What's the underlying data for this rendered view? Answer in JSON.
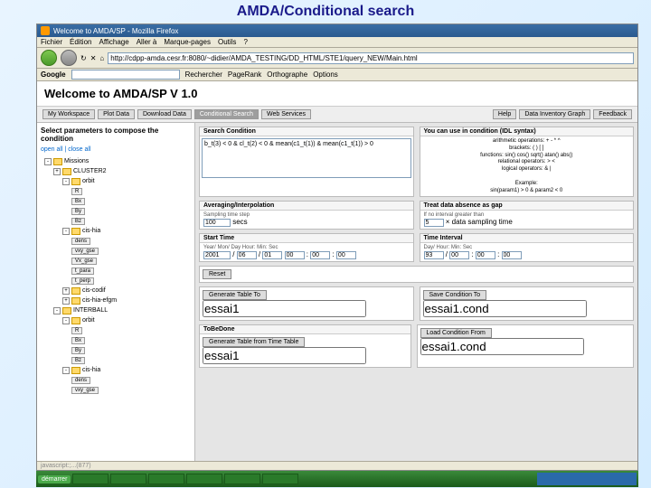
{
  "slide_title": "AMDA/Conditional search",
  "window_title": "Welcome to AMDA/SP - Mozilla Firefox",
  "menubar": [
    "Fichier",
    "Édition",
    "Affichage",
    "Aller à",
    "Marque-pages",
    "Outils",
    "?"
  ],
  "address_url": "http://cdpp-amda.cesr.fr:8080/~didier/AMDA_TESTING/DD_HTML/STE1/query_NEW/Main.html",
  "google_bar": {
    "logo": "Google",
    "items": [
      "Rechercher",
      "PageRank",
      "Orthographe",
      "Options"
    ]
  },
  "page_title": "Welcome to AMDA/SP V 1.0",
  "tabs_left": [
    "My Workspace",
    "Plot Data",
    "Download Data",
    "Conditional Search",
    "Web Services"
  ],
  "tabs_right": [
    "Help",
    "Data Inventory Graph",
    "Feedback"
  ],
  "active_tab": "Conditional Search",
  "sidebar": {
    "heading": "Select parameters to compose the condition",
    "expand_links": "open all | close all",
    "tree": [
      {
        "lvl": 0,
        "t": "toggle",
        "s": "-",
        "label": "Missions",
        "fold": true
      },
      {
        "lvl": 1,
        "t": "toggle",
        "s": "+",
        "label": "CLUSTER2",
        "fold": true
      },
      {
        "lvl": 2,
        "t": "toggle",
        "s": "-",
        "label": "orbit",
        "fold": true
      },
      {
        "lvl": 3,
        "t": "leaf",
        "label": "R"
      },
      {
        "lvl": 3,
        "t": "leaf",
        "label": "Bx"
      },
      {
        "lvl": 3,
        "t": "leaf",
        "label": "By"
      },
      {
        "lvl": 3,
        "t": "leaf",
        "label": "Bz"
      },
      {
        "lvl": 2,
        "t": "toggle",
        "s": "-",
        "label": "cis-hia",
        "fold": true
      },
      {
        "lvl": 3,
        "t": "leaf",
        "label": "dens"
      },
      {
        "lvl": 3,
        "t": "leaf",
        "label": "vxy_gse"
      },
      {
        "lvl": 3,
        "t": "leaf",
        "label": "Vx_gse"
      },
      {
        "lvl": 3,
        "t": "leaf",
        "label": "t_para"
      },
      {
        "lvl": 3,
        "t": "leaf",
        "label": "t_perp"
      },
      {
        "lvl": 2,
        "t": "toggle",
        "s": "+",
        "label": "cis-codif",
        "fold": true
      },
      {
        "lvl": 2,
        "t": "toggle",
        "s": "+",
        "label": "cis-hia-efgm",
        "fold": true
      },
      {
        "lvl": 1,
        "t": "toggle",
        "s": "-",
        "label": "INTERBALL",
        "fold": true
      },
      {
        "lvl": 2,
        "t": "toggle",
        "s": "-",
        "label": "orbit",
        "fold": true
      },
      {
        "lvl": 3,
        "t": "leaf",
        "label": "R"
      },
      {
        "lvl": 3,
        "t": "leaf",
        "label": "Bx"
      },
      {
        "lvl": 3,
        "t": "leaf",
        "label": "By"
      },
      {
        "lvl": 3,
        "t": "leaf",
        "label": "Bz"
      },
      {
        "lvl": 2,
        "t": "toggle",
        "s": "-",
        "label": "cis-hia",
        "fold": true
      },
      {
        "lvl": 3,
        "t": "leaf",
        "label": "dens"
      },
      {
        "lvl": 3,
        "t": "leaf",
        "label": "vxy_gse"
      }
    ]
  },
  "search_condition": {
    "title": "Search Condition",
    "text": "b_t(3) < 0 & cl_t(2) < 0 & mean(c1_t(1)) & mean(c1_t(1)) > 0",
    "hints_title": "You can use in condition (IDL syntax)",
    "hints_lines": [
      "arithmetic operations: + - * ^",
      "brackets: ( ) [ ]",
      "functions: sin() cos() sqrt() atan() abs()",
      "relational operators: > <",
      "logical operators: & |",
      "",
      "Example:",
      "sin(param1) > 0 & param2 < 0"
    ]
  },
  "averaging": {
    "title": "Averaging/Interpolation",
    "label": "Sampling time step",
    "value": "100",
    "unit": "secs"
  },
  "gap": {
    "title": "Treat data absence as gap",
    "label": "If no interval greater than",
    "value": "5",
    "unit": "× data sampling time"
  },
  "start_time": {
    "title": "Start Time",
    "label": "Year/ Mon/ Day  Hour: Min: Sec",
    "vals": [
      "2001",
      "06",
      "01",
      "00",
      "00",
      "00"
    ]
  },
  "time_interval": {
    "title": "Time Interval",
    "label": "Day/ Hour: Min: Sec",
    "vals": [
      "93",
      "00",
      "00",
      "00"
    ]
  },
  "reset": "Reset",
  "generate": {
    "label": "Generate Table To",
    "value": "essai1"
  },
  "save_cond": {
    "label": "Save Condition To",
    "value": "essai1.cond"
  },
  "tobedone": {
    "title": "ToBeDone",
    "btn": "Generate Table from Time Table",
    "value": "essai1"
  },
  "load_cond": {
    "label": "Load Condition From",
    "value": "essai1.cond"
  },
  "statusbar": "javascript:;...(877)",
  "taskbar_start": "démarrer"
}
